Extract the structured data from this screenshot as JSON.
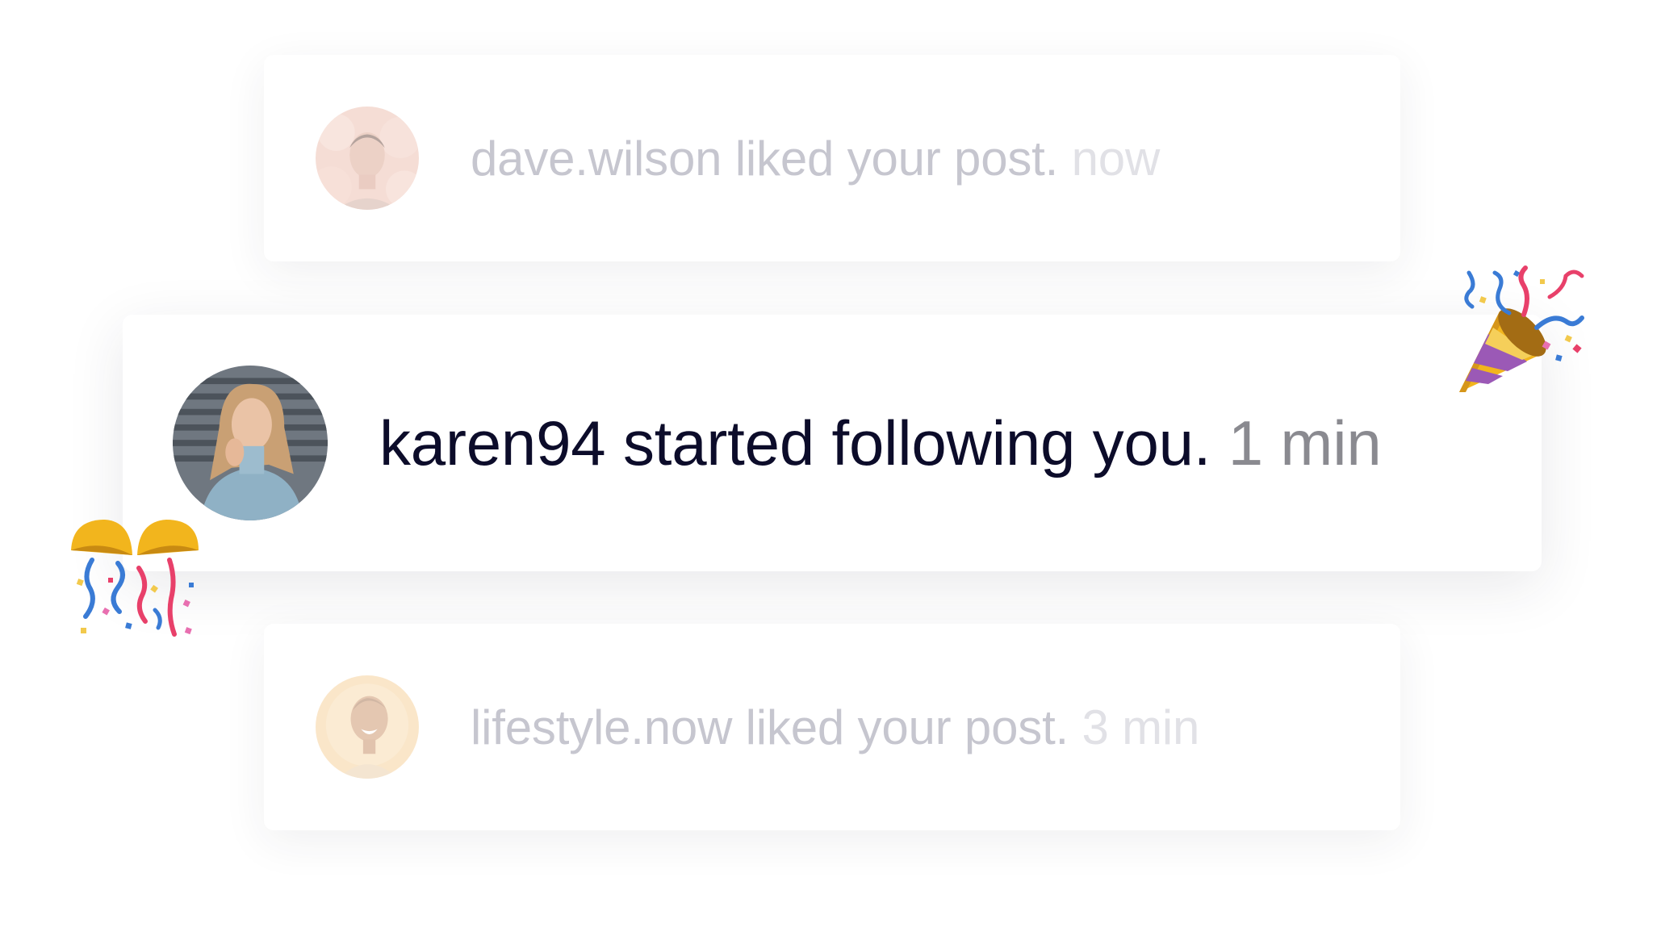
{
  "notifications": [
    {
      "message": "dave.wilson liked your post.",
      "time": "now",
      "avatar_icon": "avatar-icon",
      "state": "faded"
    },
    {
      "message": "karen94 started following you.",
      "time": "1 min",
      "avatar_icon": "avatar-icon",
      "state": "active"
    },
    {
      "message": "lifestyle.now liked your post.",
      "time": "3 min",
      "avatar_icon": "avatar-icon",
      "state": "faded"
    }
  ],
  "decorations": {
    "top_right": "party-popper-icon",
    "bottom_left": "confetti-ball-icon"
  },
  "colors": {
    "active_text": "#0c0c2a",
    "active_time": "#8a8a90",
    "faded_text": "#c6c6cf",
    "faded_time": "#e1e1e6"
  }
}
